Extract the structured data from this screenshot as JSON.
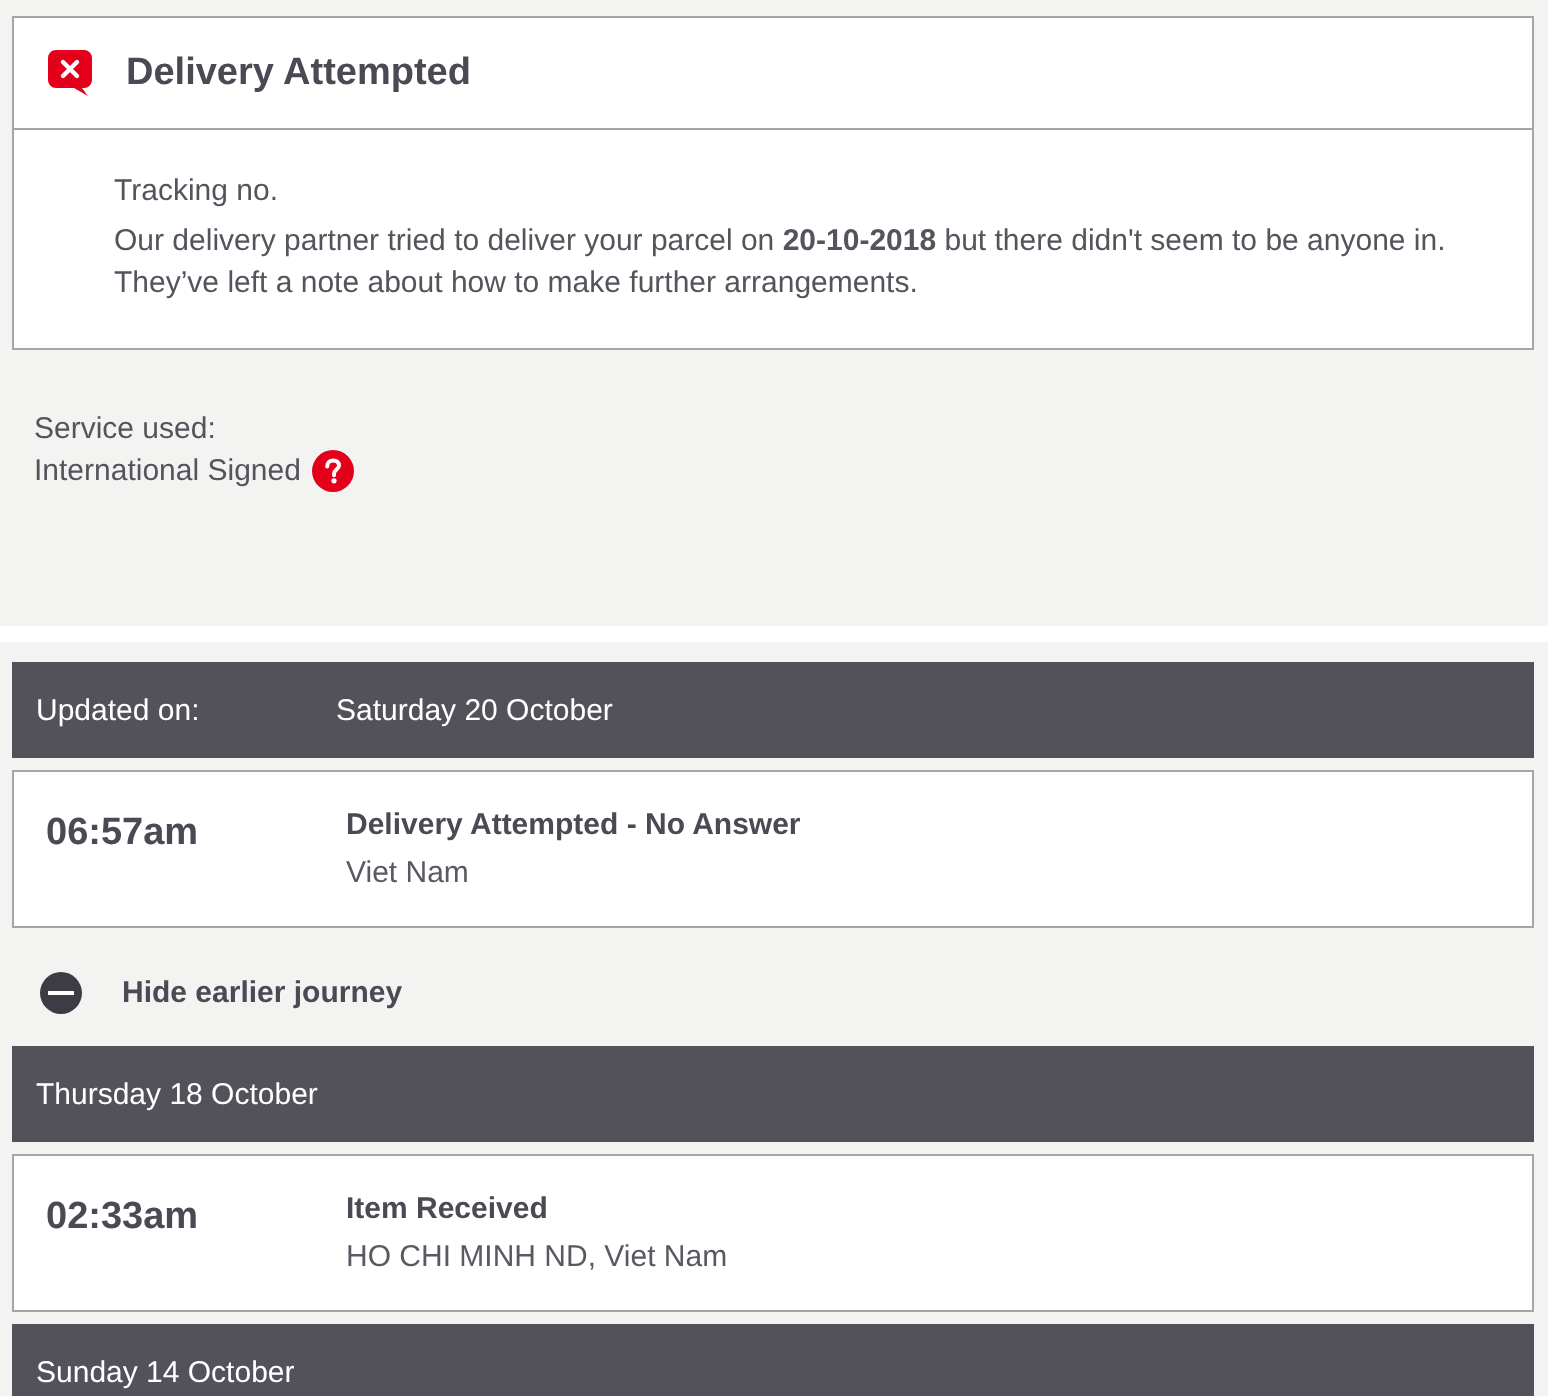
{
  "notice": {
    "title": "Delivery Attempted",
    "tracking_label": "Tracking no.",
    "message": "Our delivery partner tried to deliver your parcel on **20-10-2018** but there didn't seem to be anyone in. They’ve left a note about how to make further arrangements."
  },
  "service": {
    "label": "Service used:",
    "value": "International Signed"
  },
  "latest_update": {
    "label": "Updated on:",
    "date": "Saturday 20 October",
    "events": [
      {
        "time": "06:57am",
        "title": "Delivery Attempted - No Answer",
        "location": "Viet Nam"
      }
    ]
  },
  "journey_toggle": {
    "label": "Hide earlier journey",
    "expanded": true
  },
  "earlier_days": [
    {
      "date": "Thursday 18 October",
      "events": [
        {
          "time": "02:33am",
          "title": "Item Received",
          "location": "HO CHI MINH ND, Viet Nam"
        }
      ]
    },
    {
      "date": "Sunday 14 October"
    }
  ]
}
